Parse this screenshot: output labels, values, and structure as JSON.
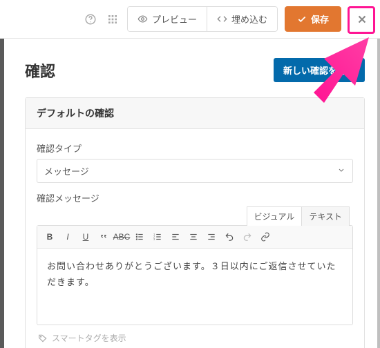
{
  "topbar": {
    "preview_label": "プレビュー",
    "embed_label": "埋め込む",
    "save_label": "保存"
  },
  "page": {
    "title": "確認",
    "new_button_label": "新しい確認を追加"
  },
  "panel": {
    "header": "デフォルトの確認",
    "type_label": "確認タイプ",
    "type_value": "メッセージ",
    "message_label": "確認メッセージ",
    "tabs": {
      "visual": "ビジュアル",
      "text": "テキスト"
    },
    "message_body": "お問い合わせありがとうございます。３日以内にご返信させていただきます。",
    "smart_tags_label": "スマートタグを表示"
  }
}
